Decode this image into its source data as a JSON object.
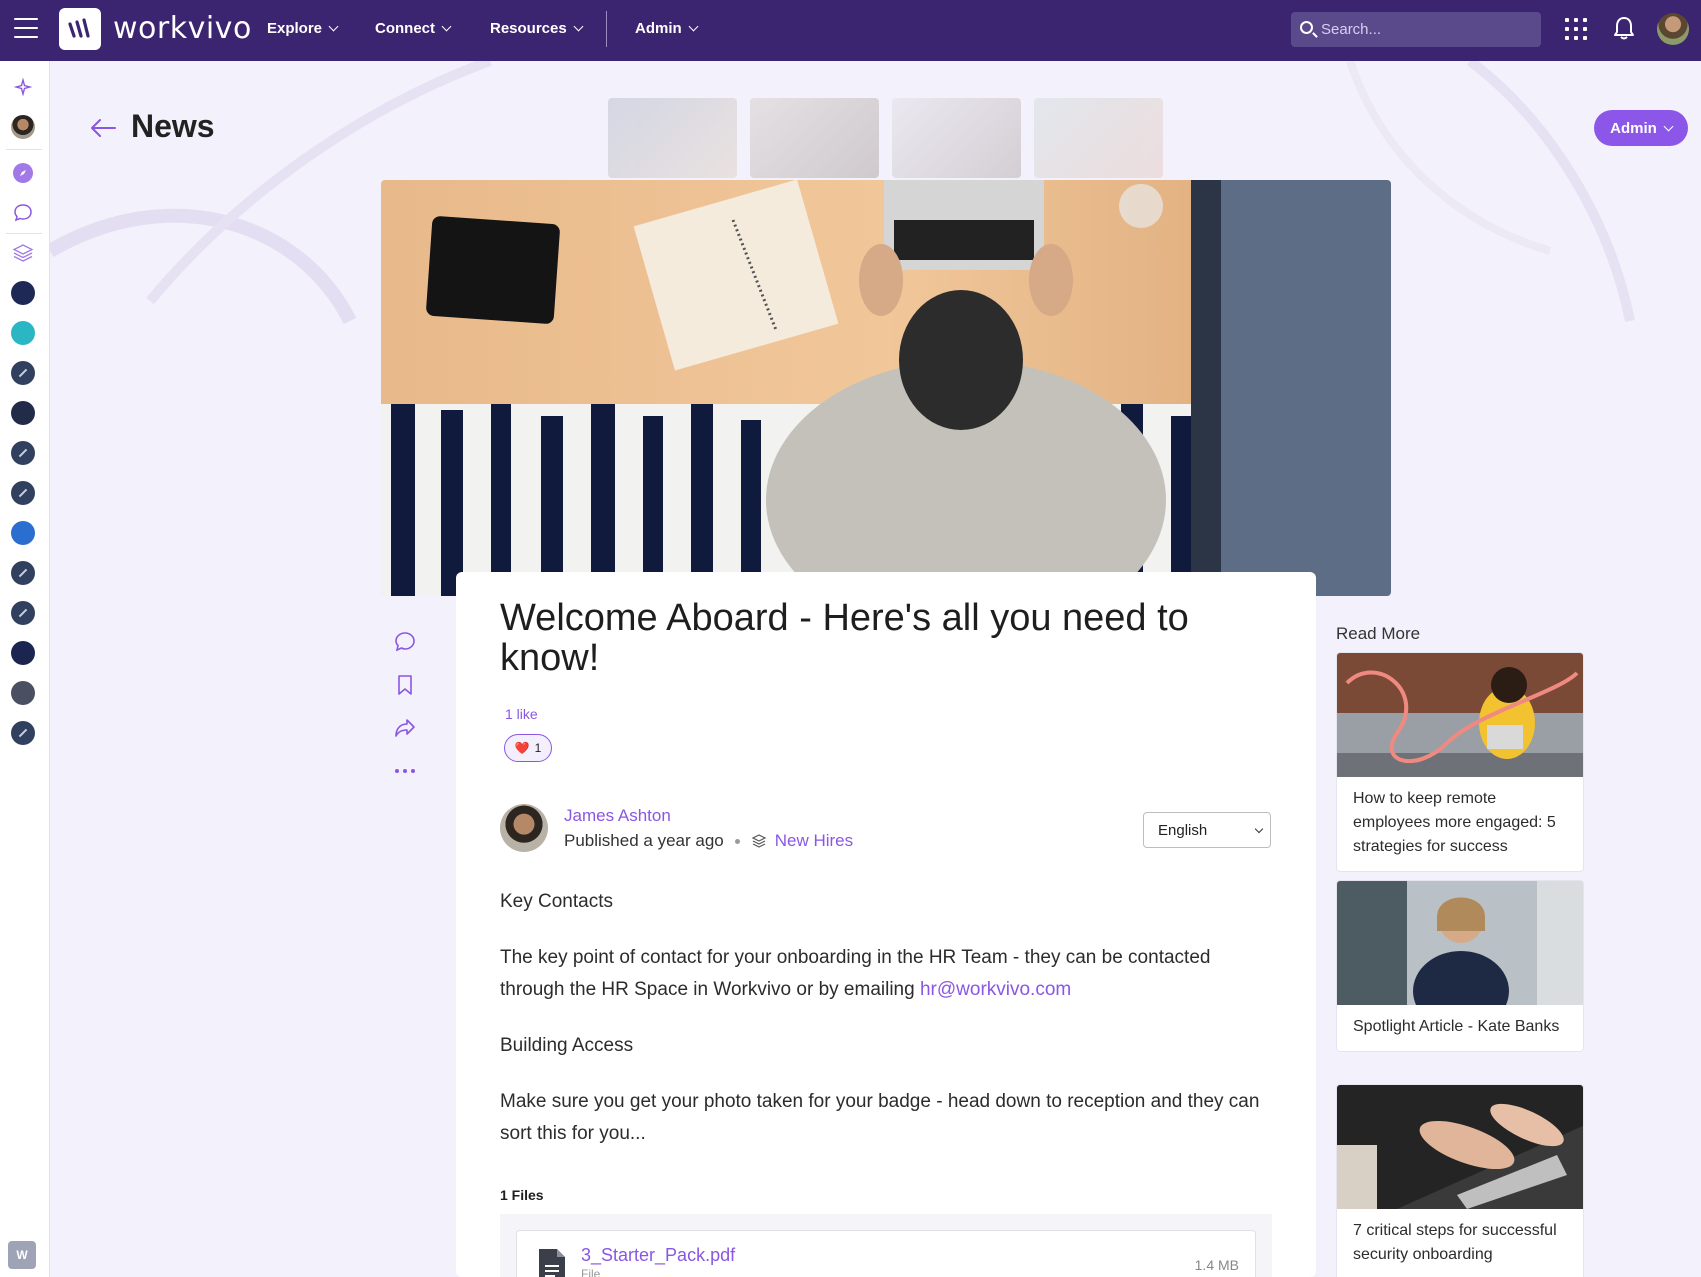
{
  "topbar": {
    "logo_text": "workvivo",
    "nav": [
      {
        "label": "Explore"
      },
      {
        "label": "Connect"
      },
      {
        "label": "Resources"
      },
      {
        "label": "Admin"
      }
    ],
    "search_placeholder": "Search...",
    "brand_color": "#3b2470"
  },
  "header": {
    "title": "News",
    "admin_button": "Admin"
  },
  "article": {
    "title": "Welcome Aboard - Here's all you need to know!",
    "likes_text": "1 like",
    "reaction_emoji": "❤️",
    "reaction_count": "1",
    "author": "James Ashton",
    "published": "Published a year ago",
    "space": "New Hires",
    "language": "English",
    "paragraphs": {
      "h1": "Key Contacts",
      "p1": "The key point of contact for your onboarding in the HR Team - they can be contacted through the HR Space in Workvivo or by emailing",
      "p1_link": "hr@workvivo.com",
      "h2": "Building Access",
      "p2": "Make sure you get your photo taken for your badge - head down to reception and they can sort this for you..."
    },
    "files_label": "1 Files",
    "file": {
      "name": "3_Starter_Pack.pdf",
      "type": "File",
      "size": "1.4 MB"
    }
  },
  "read_more": {
    "label": "Read More",
    "items": [
      {
        "title": "How to keep remote employees more engaged: 5 strategies for success"
      },
      {
        "title": "Spotlight Article - Kate Banks"
      },
      {
        "title": "7 critical steps for successful security onboarding"
      }
    ]
  },
  "accent_color": "#8a57e3"
}
